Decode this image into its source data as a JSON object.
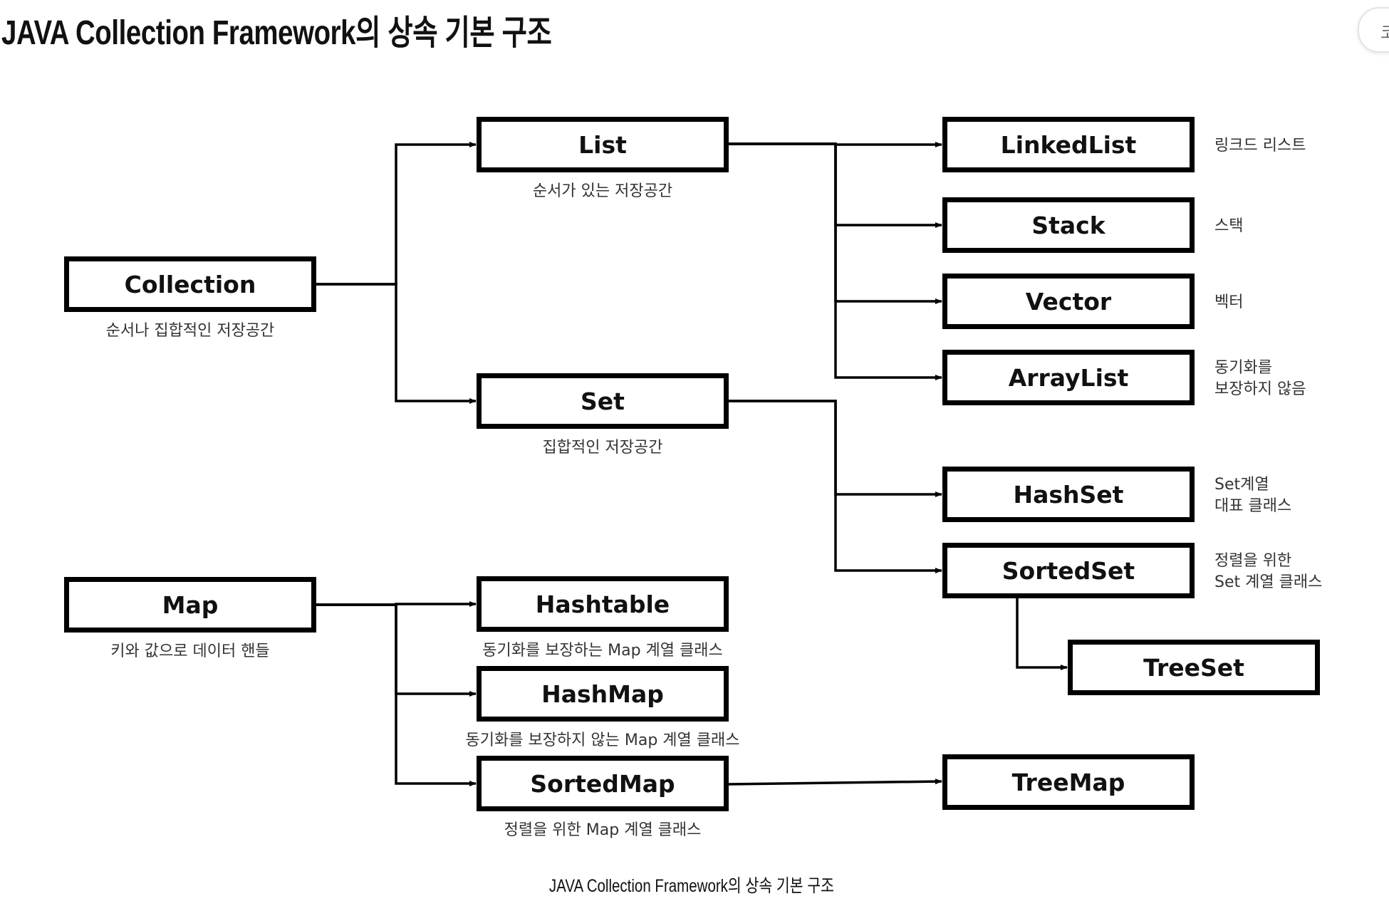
{
  "page": {
    "title": "JAVA Collection Framework의 상속 기본 구조",
    "caption": "JAVA Collection Framework의 상속 기본 구조",
    "side_button_label": "코"
  },
  "diagram": {
    "nodes": {
      "collection": {
        "label": "Collection",
        "note": [
          "순서나 집합적인 저장공간"
        ]
      },
      "list": {
        "label": "List",
        "note": [
          "순서가 있는 저장공간"
        ]
      },
      "set": {
        "label": "Set",
        "note": [
          "집합적인 저장공간"
        ]
      },
      "linkedlist": {
        "label": "LinkedList",
        "note": [
          "링크드 리스트"
        ]
      },
      "stack": {
        "label": "Stack",
        "note": [
          "스택"
        ]
      },
      "vector": {
        "label": "Vector",
        "note": [
          "벡터"
        ]
      },
      "arraylist": {
        "label": "ArrayList",
        "note": [
          "동기화를",
          "보장하지 않음"
        ]
      },
      "hashset": {
        "label": "HashSet",
        "note": [
          "Set계열",
          "대표 클래스"
        ]
      },
      "sortedset": {
        "label": "SortedSet",
        "note": [
          "정렬을 위한",
          "Set 계열 클래스"
        ]
      },
      "treeset": {
        "label": "TreeSet",
        "note": []
      },
      "map": {
        "label": "Map",
        "note": [
          "키와 값으로 데이터 핸들"
        ]
      },
      "hashtable": {
        "label": "Hashtable",
        "note": [
          "동기화를 보장하는 Map 계열 클래스"
        ]
      },
      "hashmap": {
        "label": "HashMap",
        "note": [
          "동기화를 보장하지 않는 Map 계열 클래스"
        ]
      },
      "sortedmap": {
        "label": "SortedMap",
        "note": [
          "정렬을 위한 Map 계열 클래스"
        ]
      },
      "treemap": {
        "label": "TreeMap",
        "note": []
      }
    },
    "edges": [
      [
        "collection",
        "list"
      ],
      [
        "collection",
        "set"
      ],
      [
        "list",
        "linkedlist"
      ],
      [
        "list",
        "stack"
      ],
      [
        "list",
        "vector"
      ],
      [
        "list",
        "arraylist"
      ],
      [
        "set",
        "hashset"
      ],
      [
        "set",
        "sortedset"
      ],
      [
        "sortedset",
        "treeset"
      ],
      [
        "map",
        "hashtable"
      ],
      [
        "map",
        "hashmap"
      ],
      [
        "map",
        "sortedmap"
      ],
      [
        "sortedmap",
        "treemap"
      ]
    ]
  }
}
